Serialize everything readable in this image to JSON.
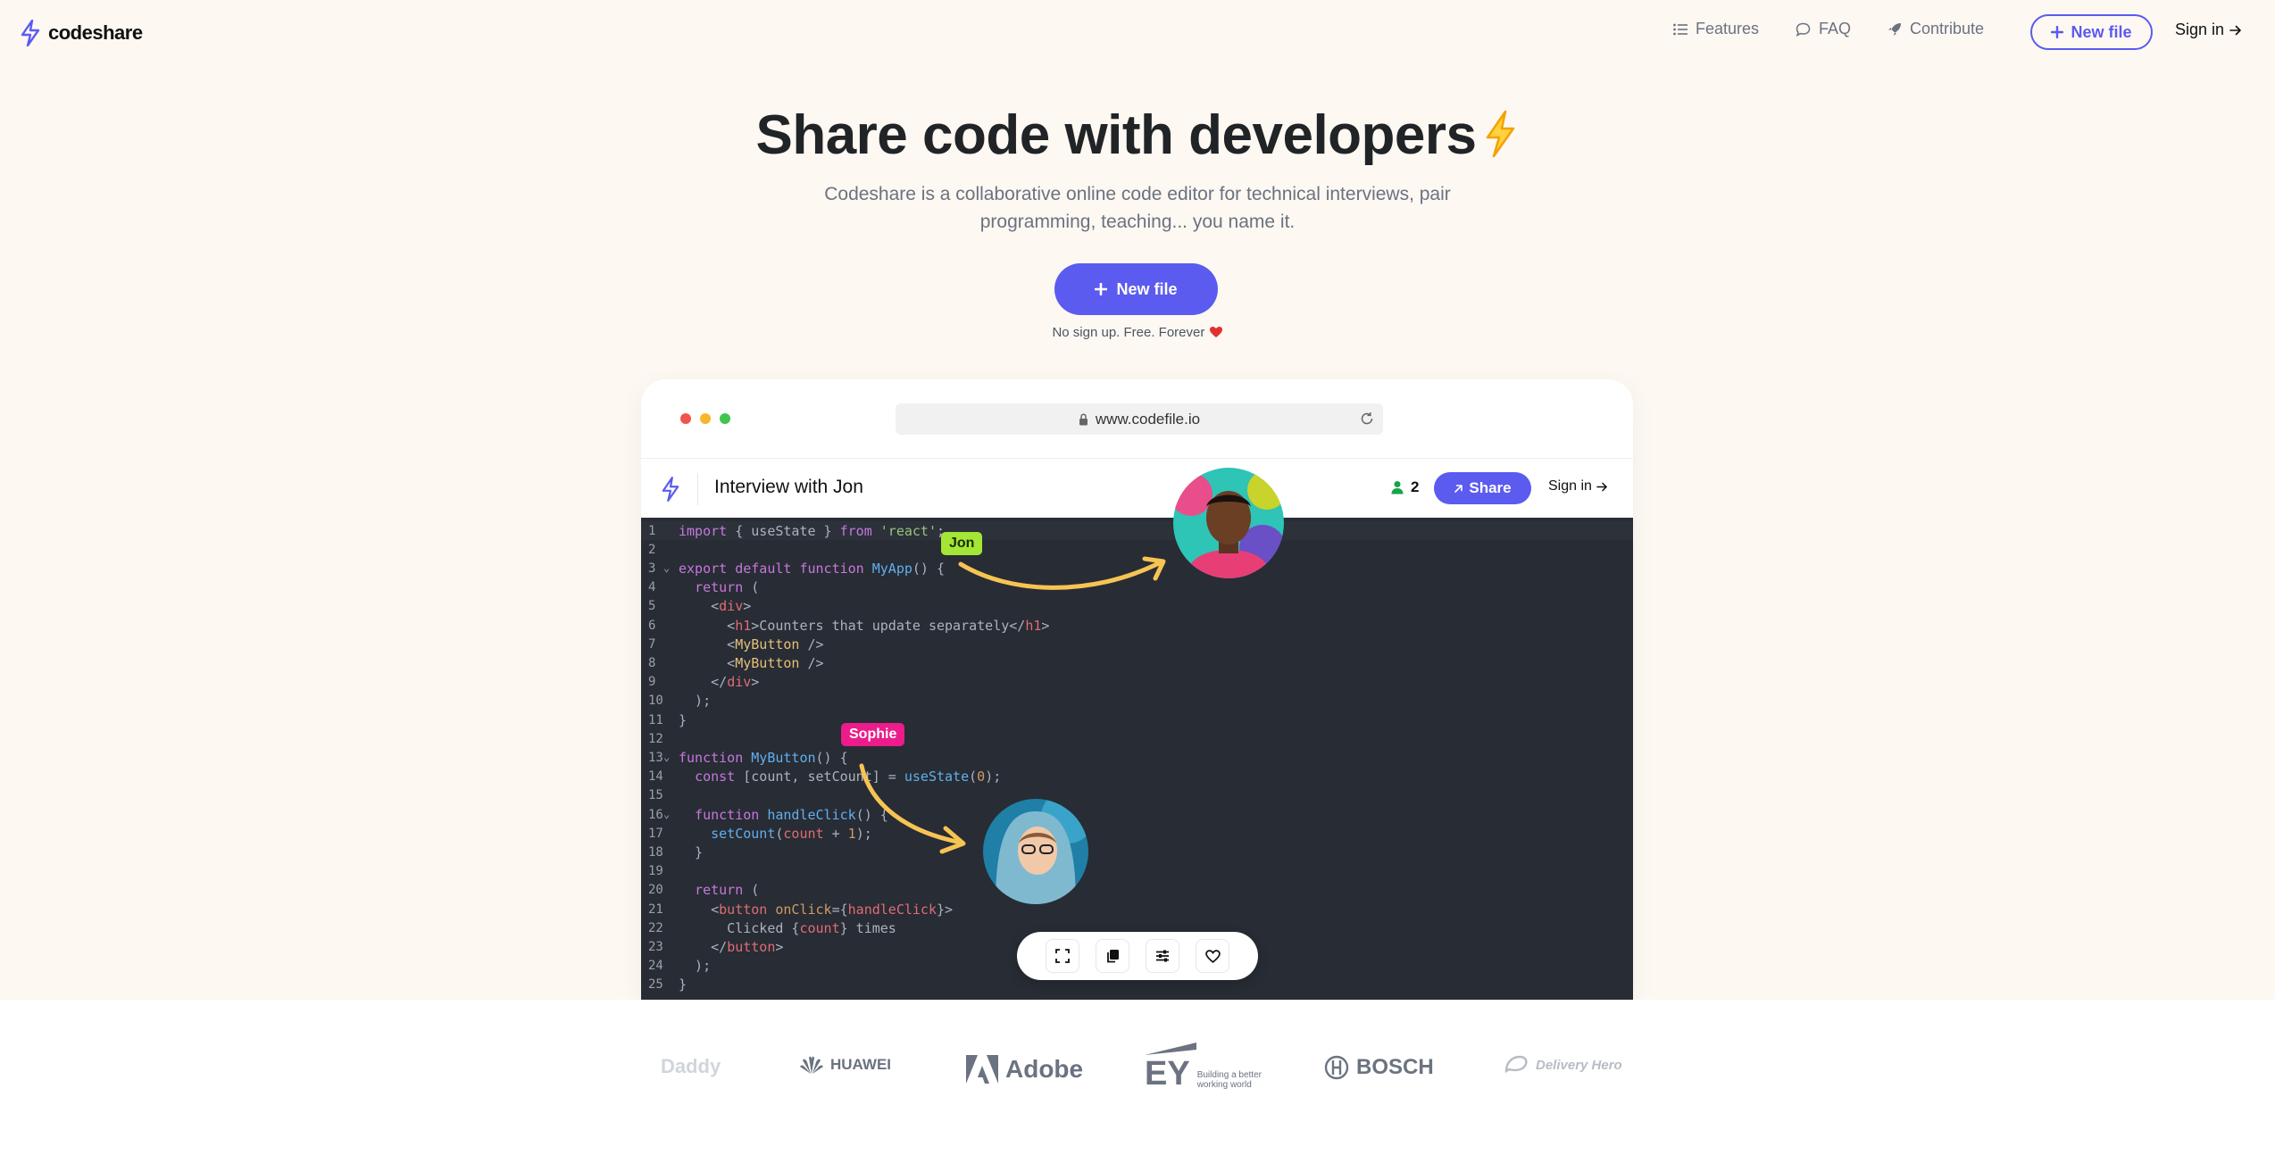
{
  "nav": {
    "brand": "codeshare",
    "links": [
      {
        "label": "Features",
        "icon": "list-icon"
      },
      {
        "label": "FAQ",
        "icon": "chat-bubble-icon"
      },
      {
        "label": "Contribute",
        "icon": "rocket-icon"
      }
    ],
    "new_file": "New file",
    "sign_in": "Sign in"
  },
  "hero": {
    "title": "Share code with developers",
    "subtitle": "Codeshare is a collaborative online code editor for technical interviews, pair programming, teaching... you name it.",
    "cta": "New file",
    "note": "No sign up. Free. Forever"
  },
  "mock": {
    "url": "www.codefile.io",
    "file_title": "Interview with Jon",
    "user_count": "2",
    "share": "Share",
    "sign_in": "Sign in",
    "cursor_users": [
      "Jon",
      "Sophie"
    ],
    "code_lines": [
      "import { useState } from 'react';",
      "",
      "export default function MyApp() {",
      "  return (",
      "    <div>",
      "      <h1>Counters that update separately</h1>",
      "      <MyButton />",
      "      <MyButton />",
      "    </div>",
      "  );",
      "}",
      "",
      "function MyButton() {",
      "  const [count, setCount] = useState(0);",
      "",
      "  function handleClick() {",
      "    setCount(count + 1);",
      "  }",
      "",
      "  return (",
      "    <button onClick={handleClick}>",
      "      Clicked {count} times",
      "    </button>",
      "  );",
      "}"
    ]
  },
  "logos": [
    "Daddy",
    "HUAWEI",
    "Adobe",
    "EY",
    "Building a better working world",
    "BOSCH",
    "Delivery Hero"
  ],
  "colors": {
    "accent": "#5b5bf0",
    "background": "#fdf8f2",
    "editor_bg": "#282c34",
    "jon_tag": "#a3e635",
    "sophie_tag": "#ec1c8a",
    "arrow": "#f6c453"
  }
}
